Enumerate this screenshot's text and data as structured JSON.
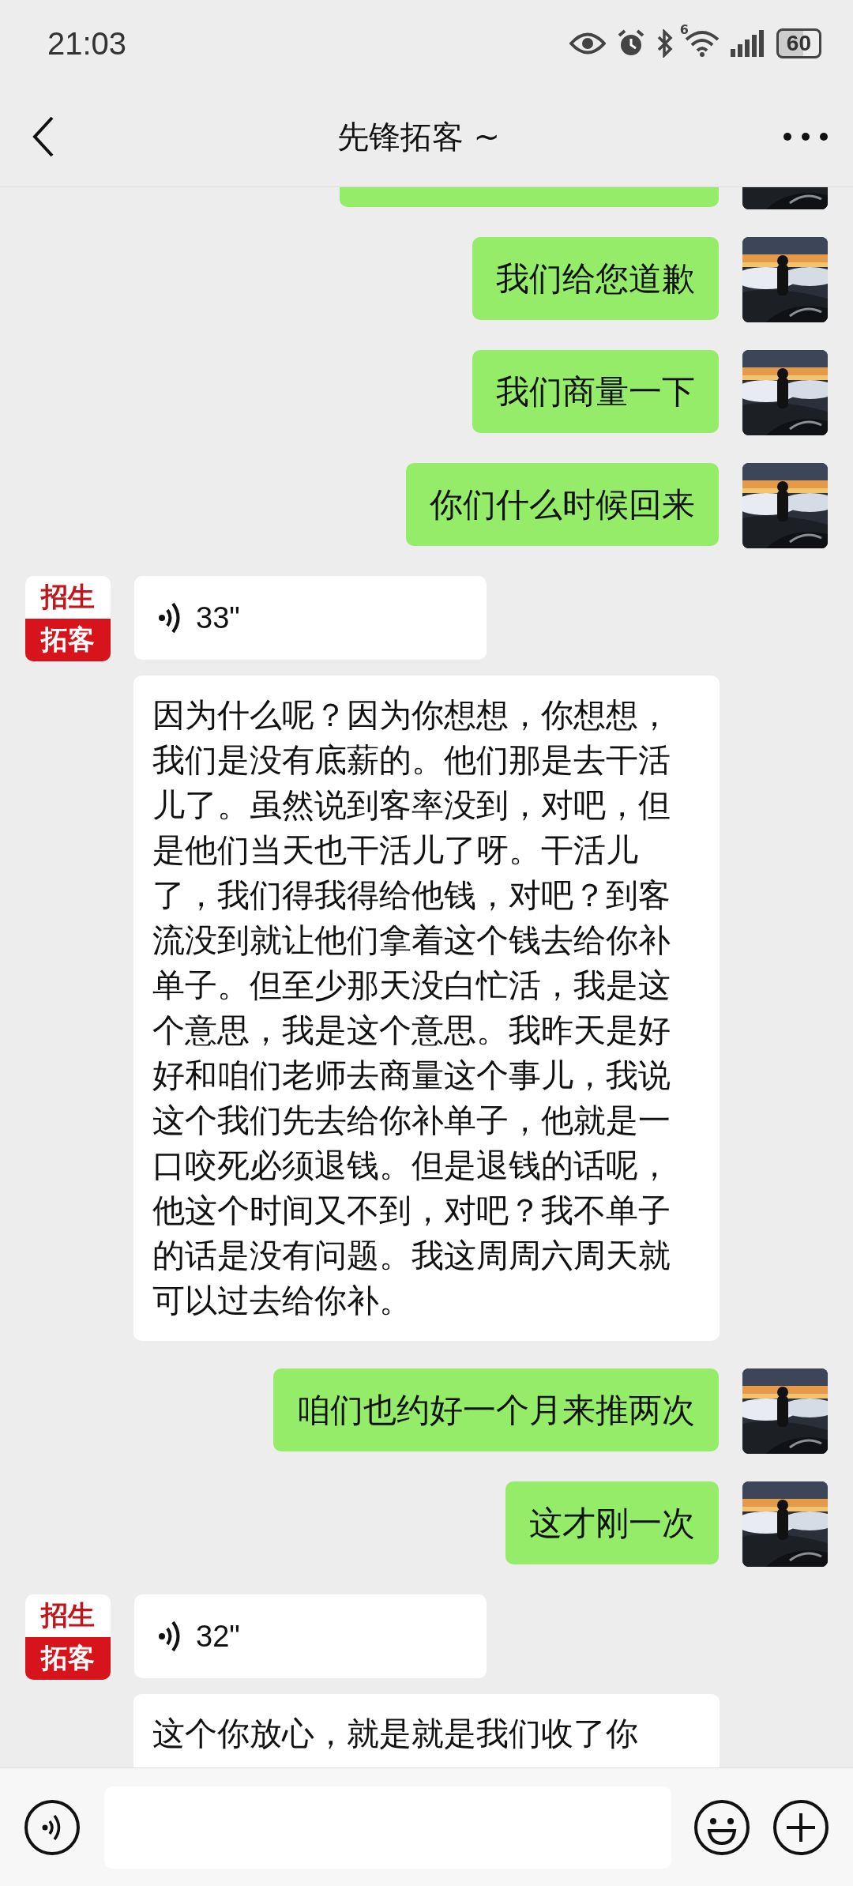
{
  "status_bar": {
    "time": "21:03",
    "network_badge": "6",
    "battery": "60"
  },
  "header": {
    "title": "先锋拓客 ~"
  },
  "messages": [
    {
      "outgoing": true,
      "kind": "partial"
    },
    {
      "outgoing": true,
      "kind": "text",
      "text": "我们给您道歉"
    },
    {
      "outgoing": true,
      "kind": "text",
      "text": "我们商量一下"
    },
    {
      "outgoing": true,
      "kind": "text",
      "text": "你们什么时候回来"
    },
    {
      "outgoing": false,
      "kind": "voice",
      "duration": "33\"",
      "avatar": [
        "招生",
        "拓客"
      ]
    },
    {
      "outgoing": false,
      "kind": "transcript",
      "text": "因为什么呢？因为你想想，你想想，我们是没有底薪的。他们那是去干活儿了。虽然说到客率没到，对吧，但是他们当天也干活儿了呀。干活儿了，我们得我得给他钱，对吧？到客流没到就让他们拿着这个钱去给你补单子。但至少那天没白忙活，我是这个意思，我是这个意思。我昨天是好好和咱们老师去商量这个事儿，我说这个我们先去给你补单子，他就是一口咬死必须退钱。但是退钱的话呢，他这个时间又不到，对吧？我不单子的话是没有问题。我这周周六周天就可以过去给你补。"
    },
    {
      "outgoing": true,
      "kind": "text",
      "text": "咱们也约好一个月来推两次"
    },
    {
      "outgoing": true,
      "kind": "text",
      "text": "这才刚一次"
    },
    {
      "outgoing": false,
      "kind": "voice",
      "duration": "32\"",
      "avatar": [
        "招生",
        "拓客"
      ]
    },
    {
      "outgoing": false,
      "kind": "transcript",
      "text": "这个你放心，就是就是我们收了你"
    }
  ]
}
